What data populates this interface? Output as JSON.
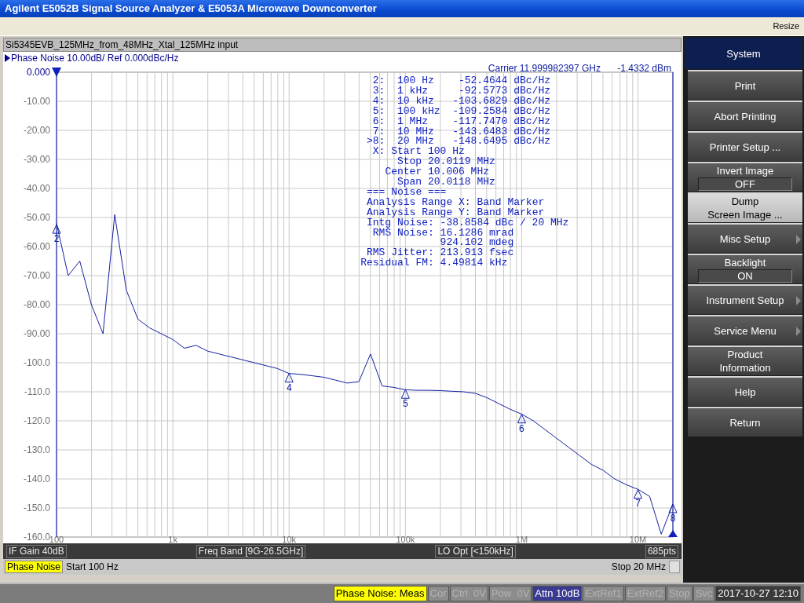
{
  "window": {
    "title": "Agilent E5052B Signal Source Analyzer & E5053A Microwave Downconverter"
  },
  "menu_bar": {
    "items": [
      "Resize"
    ]
  },
  "trace_window": {
    "title": "Si5345EVB_125MHz_from_48MHz_Xtal_125MHz input",
    "trace_label": "Phase Noise 10.00dB/ Ref 0.000dBc/Hz",
    "carrier": "Carrier 11.999982397 GHz",
    "carrier_power": "-1.4332 dBm",
    "marker_table": [
      {
        "marker": "2:",
        "freq": "100 Hz",
        "value": "-52.4644",
        "unit": "dBc/Hz"
      },
      {
        "marker": "3:",
        "freq": "1 kHz",
        "value": "-92.5773",
        "unit": "dBc/Hz"
      },
      {
        "marker": "4:",
        "freq": "10 kHz",
        "value": "-103.6829",
        "unit": "dBc/Hz"
      },
      {
        "marker": "5:",
        "freq": "100 kHz",
        "value": "-109.2584",
        "unit": "dBc/Hz"
      },
      {
        "marker": "6:",
        "freq": "1 MHz",
        "value": "-117.7470",
        "unit": "dBc/Hz"
      },
      {
        "marker": "7:",
        "freq": "10 MHz",
        "value": "-143.6483",
        "unit": "dBc/Hz"
      },
      {
        "marker": ">8:",
        "freq": "20 MHz",
        "value": "-148.6495",
        "unit": "dBc/Hz"
      }
    ],
    "sweep_lines": [
      {
        "label": "X: Start",
        "value": "100 Hz"
      },
      {
        "label": "Stop",
        "value": "20.0119 MHz"
      },
      {
        "label": "Center",
        "value": "10.006 MHz"
      },
      {
        "label": "Span",
        "value": "20.0118 MHz"
      }
    ],
    "noise_lines": [
      {
        "kind": "text",
        "label": "=== Noise ==="
      },
      {
        "kind": "text",
        "label": "Analysis Range X: Band Marker"
      },
      {
        "kind": "text",
        "label": "Analysis Range Y: Band Marker"
      },
      {
        "kind": "pair",
        "label": "Intg Noise:",
        "value": "-38.8584 dBc / 20 MHz"
      },
      {
        "kind": "pair",
        "label": "RMS Noise:",
        "value": "16.1286 mrad"
      },
      {
        "kind": "pair",
        "value": "924.102 mdeg"
      },
      {
        "kind": "pair",
        "label": "RMS Jitter:",
        "value": "213.913 fsec"
      },
      {
        "kind": "pair",
        "label": "Residual FM:",
        "value": "4.49814 kHz"
      }
    ],
    "chart_data": {
      "type": "line",
      "categories": [
        "100",
        null,
        null,
        null,
        null,
        null,
        null,
        null,
        null,
        null,
        "1k",
        null,
        null,
        null,
        null,
        null,
        null,
        null,
        null,
        null,
        "10k",
        null,
        null,
        null,
        null,
        null,
        null,
        null,
        null,
        null,
        "100k",
        null,
        null,
        null,
        null,
        null,
        null,
        null,
        null,
        null,
        "1M",
        null,
        null,
        null,
        null,
        null,
        null,
        null,
        null,
        null,
        "10M",
        null,
        null,
        null
      ],
      "values": [
        -52,
        -70,
        -65,
        -80,
        -90,
        -49,
        -75,
        -85,
        -88,
        -90,
        -92,
        -95,
        -94,
        -96,
        -97,
        -98,
        -99,
        -100,
        -101,
        -102,
        -103.7,
        -104,
        -104.5,
        -105,
        -106,
        -107,
        -106.5,
        -97,
        -108,
        -108.5,
        -109.3,
        -109.5,
        -109.5,
        -109.6,
        -109.8,
        -110,
        -110.5,
        -112,
        -114,
        -116,
        -117.7,
        -120,
        -123,
        -126,
        -129,
        -132,
        -135,
        -137,
        -140,
        -142,
        -143.6,
        -146,
        -159,
        -148.6
      ],
      "ylim": [
        -160,
        0
      ],
      "grid": true,
      "yticks": [
        {
          "value": 0,
          "label": "0.000"
        },
        {
          "value": -10,
          "label": "-10.00"
        },
        {
          "value": -20,
          "label": "-20.00"
        },
        {
          "value": -30,
          "label": "-30.00"
        },
        {
          "value": -40,
          "label": "-40.00"
        },
        {
          "value": -50,
          "label": "-50.00"
        },
        {
          "value": -60,
          "label": "-60.00"
        },
        {
          "value": -70,
          "label": "-70.00"
        },
        {
          "value": -80,
          "label": "-80.00"
        },
        {
          "value": -90,
          "label": "-90.00"
        },
        {
          "value": -100,
          "label": "-100.0"
        },
        {
          "value": -110,
          "label": "-110.0"
        },
        {
          "value": -120,
          "label": "-120.0"
        },
        {
          "value": -130,
          "label": "-130.0"
        },
        {
          "value": -140,
          "label": "-140.0"
        },
        {
          "value": -150,
          "label": "-150.0"
        },
        {
          "value": -160,
          "label": "-160.0"
        }
      ],
      "annotations": [
        {
          "text": "2",
          "x": "100",
          "y": -52.4644
        },
        {
          "text": "4",
          "x": "10k",
          "y": -103.6829
        },
        {
          "text": "5",
          "x": "100k",
          "y": -109.2584
        },
        {
          "text": "6",
          "x": "1M",
          "y": -117.747
        },
        {
          "text": "7",
          "x": "10M",
          "y": -143.6483
        },
        {
          "text": "8",
          "y": -148.6495
        }
      ]
    },
    "info_bar": [
      "IF Gain 40dB",
      "Freq Band [9G-26.5GHz]",
      "LO Opt [<150kHz]",
      "685pts"
    ]
  },
  "channel_bar": {
    "measurement": "Phase Noise",
    "start": "Start 100 Hz",
    "stop": "Stop 20 MHz"
  },
  "softkeys": [
    {
      "kind": "title",
      "label": "System",
      "selected": false
    },
    {
      "kind": "button",
      "label": "Print",
      "selected": false
    },
    {
      "kind": "button",
      "label": "Abort Printing",
      "selected": false
    },
    {
      "kind": "button",
      "label": "Printer Setup ...",
      "selected": false
    },
    {
      "kind": "toggle",
      "label": "Invert Image",
      "value": "OFF",
      "selected": false
    },
    {
      "kind": "button",
      "label": "Dump\nScreen Image ...",
      "selected": true
    },
    {
      "kind": "submenu",
      "label": "Misc Setup",
      "selected": false
    },
    {
      "kind": "toggle",
      "label": "Backlight",
      "value": "ON",
      "selected": false
    },
    {
      "kind": "submenu",
      "label": "Instrument Setup",
      "selected": false
    },
    {
      "kind": "submenu",
      "label": "Service Menu",
      "selected": false
    },
    {
      "kind": "button",
      "label": "Product\nInformation",
      "selected": false
    },
    {
      "kind": "button",
      "label": "Help",
      "selected": false
    },
    {
      "kind": "button",
      "label": "Return",
      "selected": false
    }
  ],
  "status_bar": [
    {
      "kind": "highlight",
      "label": "Phase Noise: Meas"
    },
    {
      "kind": "dim",
      "label": "Cor"
    },
    {
      "kind": "dim",
      "label": "Ctrl  0V"
    },
    {
      "kind": "dim",
      "label": "Pow  0V"
    },
    {
      "kind": "active",
      "label": "Attn 10dB"
    },
    {
      "kind": "dim",
      "label": "ExtRef1"
    },
    {
      "kind": "dim",
      "label": "ExtRef2"
    },
    {
      "kind": "dim",
      "label": "Stop"
    },
    {
      "kind": "dim",
      "label": "Svc"
    },
    {
      "kind": "clock",
      "label": "2017-10-27 12:10"
    }
  ]
}
